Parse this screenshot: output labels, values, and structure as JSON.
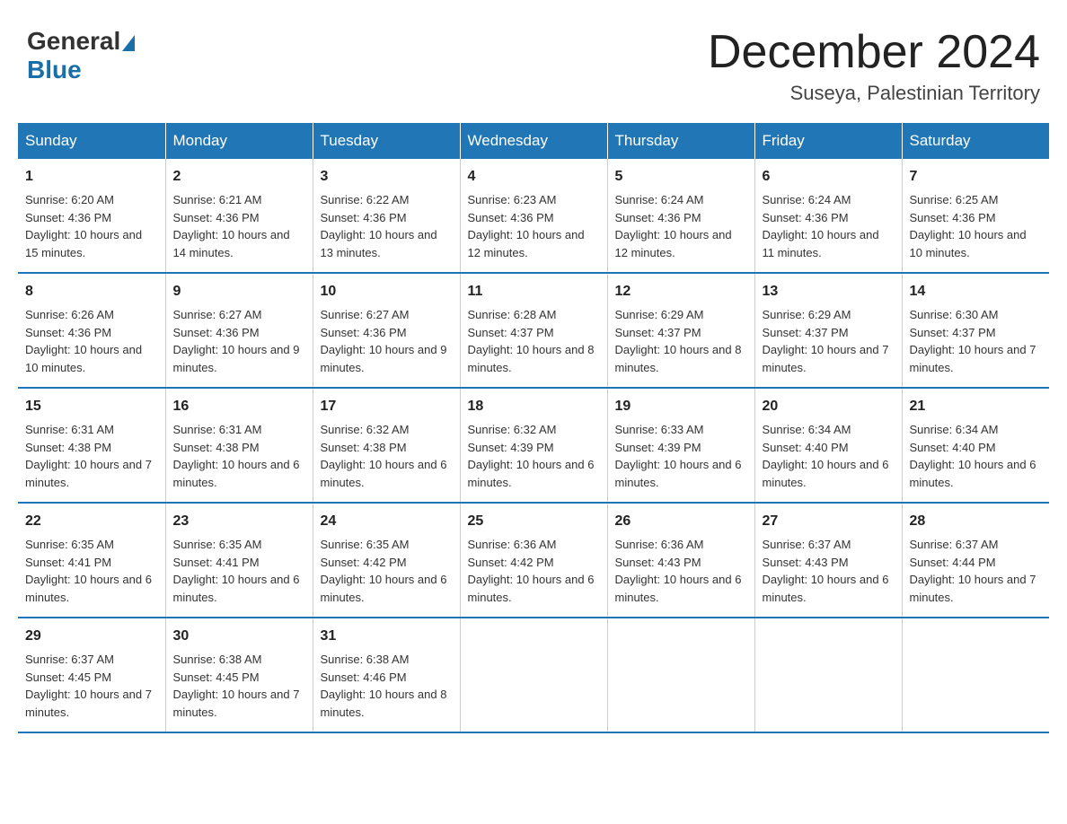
{
  "logo": {
    "text1": "General",
    "text2": "Blue"
  },
  "title": "December 2024",
  "location": "Suseya, Palestinian Territory",
  "weekdays": [
    "Sunday",
    "Monday",
    "Tuesday",
    "Wednesday",
    "Thursday",
    "Friday",
    "Saturday"
  ],
  "weeks": [
    [
      {
        "day": "1",
        "sunrise": "6:20 AM",
        "sunset": "4:36 PM",
        "daylight": "10 hours and 15 minutes."
      },
      {
        "day": "2",
        "sunrise": "6:21 AM",
        "sunset": "4:36 PM",
        "daylight": "10 hours and 14 minutes."
      },
      {
        "day": "3",
        "sunrise": "6:22 AM",
        "sunset": "4:36 PM",
        "daylight": "10 hours and 13 minutes."
      },
      {
        "day": "4",
        "sunrise": "6:23 AM",
        "sunset": "4:36 PM",
        "daylight": "10 hours and 12 minutes."
      },
      {
        "day": "5",
        "sunrise": "6:24 AM",
        "sunset": "4:36 PM",
        "daylight": "10 hours and 12 minutes."
      },
      {
        "day": "6",
        "sunrise": "6:24 AM",
        "sunset": "4:36 PM",
        "daylight": "10 hours and 11 minutes."
      },
      {
        "day": "7",
        "sunrise": "6:25 AM",
        "sunset": "4:36 PM",
        "daylight": "10 hours and 10 minutes."
      }
    ],
    [
      {
        "day": "8",
        "sunrise": "6:26 AM",
        "sunset": "4:36 PM",
        "daylight": "10 hours and 10 minutes."
      },
      {
        "day": "9",
        "sunrise": "6:27 AM",
        "sunset": "4:36 PM",
        "daylight": "10 hours and 9 minutes."
      },
      {
        "day": "10",
        "sunrise": "6:27 AM",
        "sunset": "4:36 PM",
        "daylight": "10 hours and 9 minutes."
      },
      {
        "day": "11",
        "sunrise": "6:28 AM",
        "sunset": "4:37 PM",
        "daylight": "10 hours and 8 minutes."
      },
      {
        "day": "12",
        "sunrise": "6:29 AM",
        "sunset": "4:37 PM",
        "daylight": "10 hours and 8 minutes."
      },
      {
        "day": "13",
        "sunrise": "6:29 AM",
        "sunset": "4:37 PM",
        "daylight": "10 hours and 7 minutes."
      },
      {
        "day": "14",
        "sunrise": "6:30 AM",
        "sunset": "4:37 PM",
        "daylight": "10 hours and 7 minutes."
      }
    ],
    [
      {
        "day": "15",
        "sunrise": "6:31 AM",
        "sunset": "4:38 PM",
        "daylight": "10 hours and 7 minutes."
      },
      {
        "day": "16",
        "sunrise": "6:31 AM",
        "sunset": "4:38 PM",
        "daylight": "10 hours and 6 minutes."
      },
      {
        "day": "17",
        "sunrise": "6:32 AM",
        "sunset": "4:38 PM",
        "daylight": "10 hours and 6 minutes."
      },
      {
        "day": "18",
        "sunrise": "6:32 AM",
        "sunset": "4:39 PM",
        "daylight": "10 hours and 6 minutes."
      },
      {
        "day": "19",
        "sunrise": "6:33 AM",
        "sunset": "4:39 PM",
        "daylight": "10 hours and 6 minutes."
      },
      {
        "day": "20",
        "sunrise": "6:34 AM",
        "sunset": "4:40 PM",
        "daylight": "10 hours and 6 minutes."
      },
      {
        "day": "21",
        "sunrise": "6:34 AM",
        "sunset": "4:40 PM",
        "daylight": "10 hours and 6 minutes."
      }
    ],
    [
      {
        "day": "22",
        "sunrise": "6:35 AM",
        "sunset": "4:41 PM",
        "daylight": "10 hours and 6 minutes."
      },
      {
        "day": "23",
        "sunrise": "6:35 AM",
        "sunset": "4:41 PM",
        "daylight": "10 hours and 6 minutes."
      },
      {
        "day": "24",
        "sunrise": "6:35 AM",
        "sunset": "4:42 PM",
        "daylight": "10 hours and 6 minutes."
      },
      {
        "day": "25",
        "sunrise": "6:36 AM",
        "sunset": "4:42 PM",
        "daylight": "10 hours and 6 minutes."
      },
      {
        "day": "26",
        "sunrise": "6:36 AM",
        "sunset": "4:43 PM",
        "daylight": "10 hours and 6 minutes."
      },
      {
        "day": "27",
        "sunrise": "6:37 AM",
        "sunset": "4:43 PM",
        "daylight": "10 hours and 6 minutes."
      },
      {
        "day": "28",
        "sunrise": "6:37 AM",
        "sunset": "4:44 PM",
        "daylight": "10 hours and 7 minutes."
      }
    ],
    [
      {
        "day": "29",
        "sunrise": "6:37 AM",
        "sunset": "4:45 PM",
        "daylight": "10 hours and 7 minutes."
      },
      {
        "day": "30",
        "sunrise": "6:38 AM",
        "sunset": "4:45 PM",
        "daylight": "10 hours and 7 minutes."
      },
      {
        "day": "31",
        "sunrise": "6:38 AM",
        "sunset": "4:46 PM",
        "daylight": "10 hours and 8 minutes."
      },
      {
        "day": "",
        "sunrise": "",
        "sunset": "",
        "daylight": ""
      },
      {
        "day": "",
        "sunrise": "",
        "sunset": "",
        "daylight": ""
      },
      {
        "day": "",
        "sunrise": "",
        "sunset": "",
        "daylight": ""
      },
      {
        "day": "",
        "sunrise": "",
        "sunset": "",
        "daylight": ""
      }
    ]
  ]
}
